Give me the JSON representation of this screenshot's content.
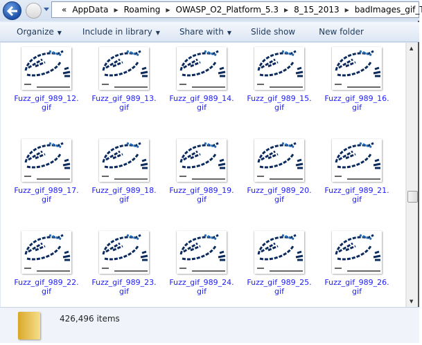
{
  "breadcrumb": {
    "overflow": "«",
    "items": [
      "AppData",
      "Roaming",
      "OWASP_O2_Platform_5.3",
      "8_15_2013",
      "badImages_gif_True"
    ]
  },
  "toolbar": {
    "organize": "Organize",
    "include": "Include in library",
    "share": "Share with",
    "slideshow": "Slide show",
    "newfolder": "New folder"
  },
  "files": [
    "Fuzz_gif_989_12.gif",
    "Fuzz_gif_989_13.gif",
    "Fuzz_gif_989_14.gif",
    "Fuzz_gif_989_15.gif",
    "Fuzz_gif_989_16.gif",
    "Fuzz_gif_989_17.gif",
    "Fuzz_gif_989_18.gif",
    "Fuzz_gif_989_19.gif",
    "Fuzz_gif_989_20.gif",
    "Fuzz_gif_989_21.gif",
    "Fuzz_gif_989_22.gif",
    "Fuzz_gif_989_23.gif",
    "Fuzz_gif_989_24.gif",
    "Fuzz_gif_989_25.gif",
    "Fuzz_gif_989_26.gif"
  ],
  "status": {
    "count": "426,496 items"
  },
  "colors": {
    "link": "#1a1aff",
    "accent": "#1d4fa8"
  }
}
